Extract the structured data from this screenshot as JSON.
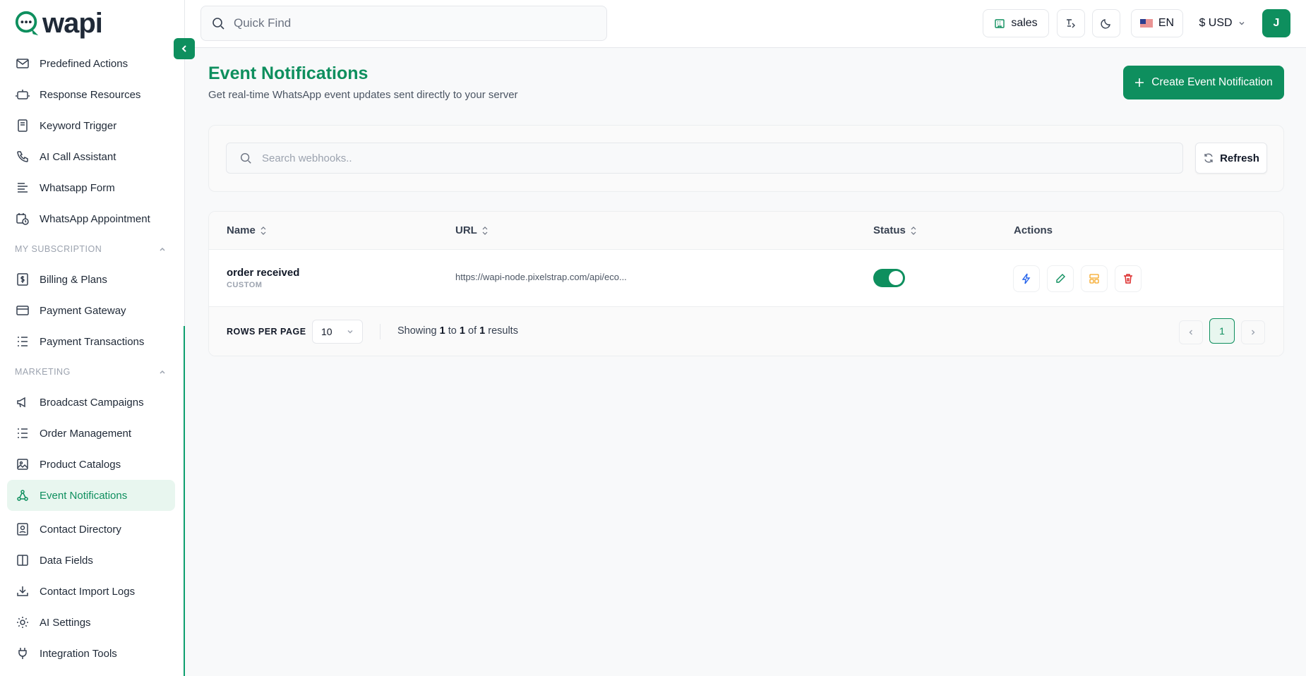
{
  "app": {
    "logo_text": "wapi"
  },
  "topbar": {
    "search_placeholder": "Quick Find",
    "workspace": "sales",
    "language": "EN",
    "currency": "$ USD",
    "avatar_initial": "J"
  },
  "sidebar": {
    "items_a": [
      {
        "label": "Predefined Actions",
        "icon": "mail-icon"
      },
      {
        "label": "Response Resources",
        "icon": "robot-icon"
      },
      {
        "label": "Keyword Trigger",
        "icon": "notebook-icon"
      },
      {
        "label": "AI Call Assistant",
        "icon": "phone-icon"
      },
      {
        "label": "Whatsapp Form",
        "icon": "form-icon"
      },
      {
        "label": "WhatsApp Appointment",
        "icon": "calendar-clock-icon"
      }
    ],
    "section_subscription": "MY SUBSCRIPTION",
    "items_b": [
      {
        "label": "Billing & Plans",
        "icon": "billing-icon"
      },
      {
        "label": "Payment Gateway",
        "icon": "card-icon"
      },
      {
        "label": "Payment Transactions",
        "icon": "list-icon"
      }
    ],
    "section_marketing": "MARKETING",
    "items_c": [
      {
        "label": "Broadcast Campaigns",
        "icon": "megaphone-icon"
      },
      {
        "label": "Order Management",
        "icon": "list-icon"
      },
      {
        "label": "Product Catalogs",
        "icon": "image-icon"
      },
      {
        "label": "Event Notifications",
        "icon": "webhook-icon",
        "active": true
      },
      {
        "label": "Contact Directory",
        "icon": "contact-icon"
      },
      {
        "label": "Data Fields",
        "icon": "columns-icon"
      },
      {
        "label": "Contact Import Logs",
        "icon": "import-icon"
      },
      {
        "label": "AI Settings",
        "icon": "gear-icon"
      },
      {
        "label": "Integration Tools",
        "icon": "plug-icon"
      }
    ]
  },
  "page": {
    "title": "Event Notifications",
    "subtitle": "Get real-time WhatsApp event updates sent directly to your server",
    "create_button": "Create Event Notification",
    "search_placeholder": "Search webhooks..",
    "refresh_button": "Refresh"
  },
  "table": {
    "headers": {
      "name": "Name",
      "url": "URL",
      "status": "Status",
      "actions": "Actions"
    },
    "rows": [
      {
        "name": "order received",
        "type": "CUSTOM",
        "url": "https://wapi-node.pixelstrap.com/api/eco...",
        "status": "enabled"
      }
    ],
    "footer": {
      "rows_per_page_label": "ROWS PER PAGE",
      "rows_per_page_value": "10",
      "showing_prefix": "Showing",
      "from": "1",
      "to_word": "to",
      "to": "1",
      "of_word": "of",
      "total": "1",
      "results_word": "results",
      "current_page": "1"
    }
  },
  "colors": {
    "brand": "#0e8f5e",
    "brand_light": "#e8f6ef"
  }
}
